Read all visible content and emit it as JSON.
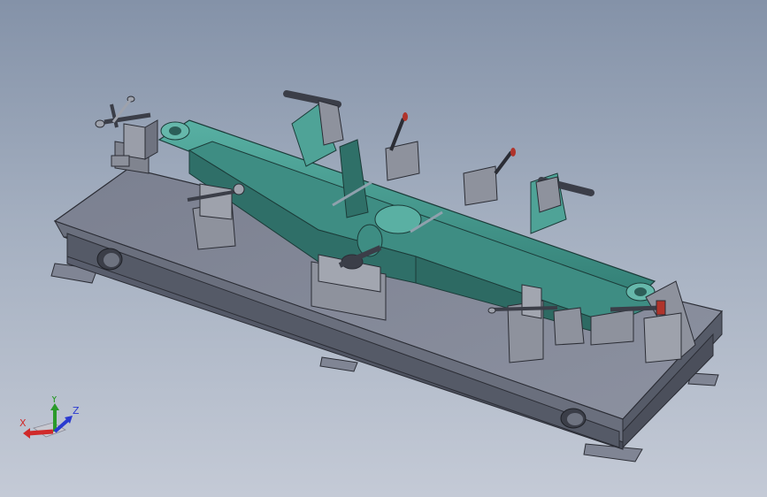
{
  "viewport": {
    "background_top": "#8492a8",
    "background_bottom": "#c4cad6"
  },
  "model": {
    "base_color": "#5f6472",
    "fixture_color": "#838796",
    "part_color": "#3a8a80",
    "part_highlight": "#5bb0a3"
  },
  "triad": {
    "x_label": "X",
    "y_label": "Y",
    "z_label": "Z",
    "x_color": "#d02a2a",
    "y_color": "#2a9a2a",
    "z_color": "#2a3ad0"
  }
}
